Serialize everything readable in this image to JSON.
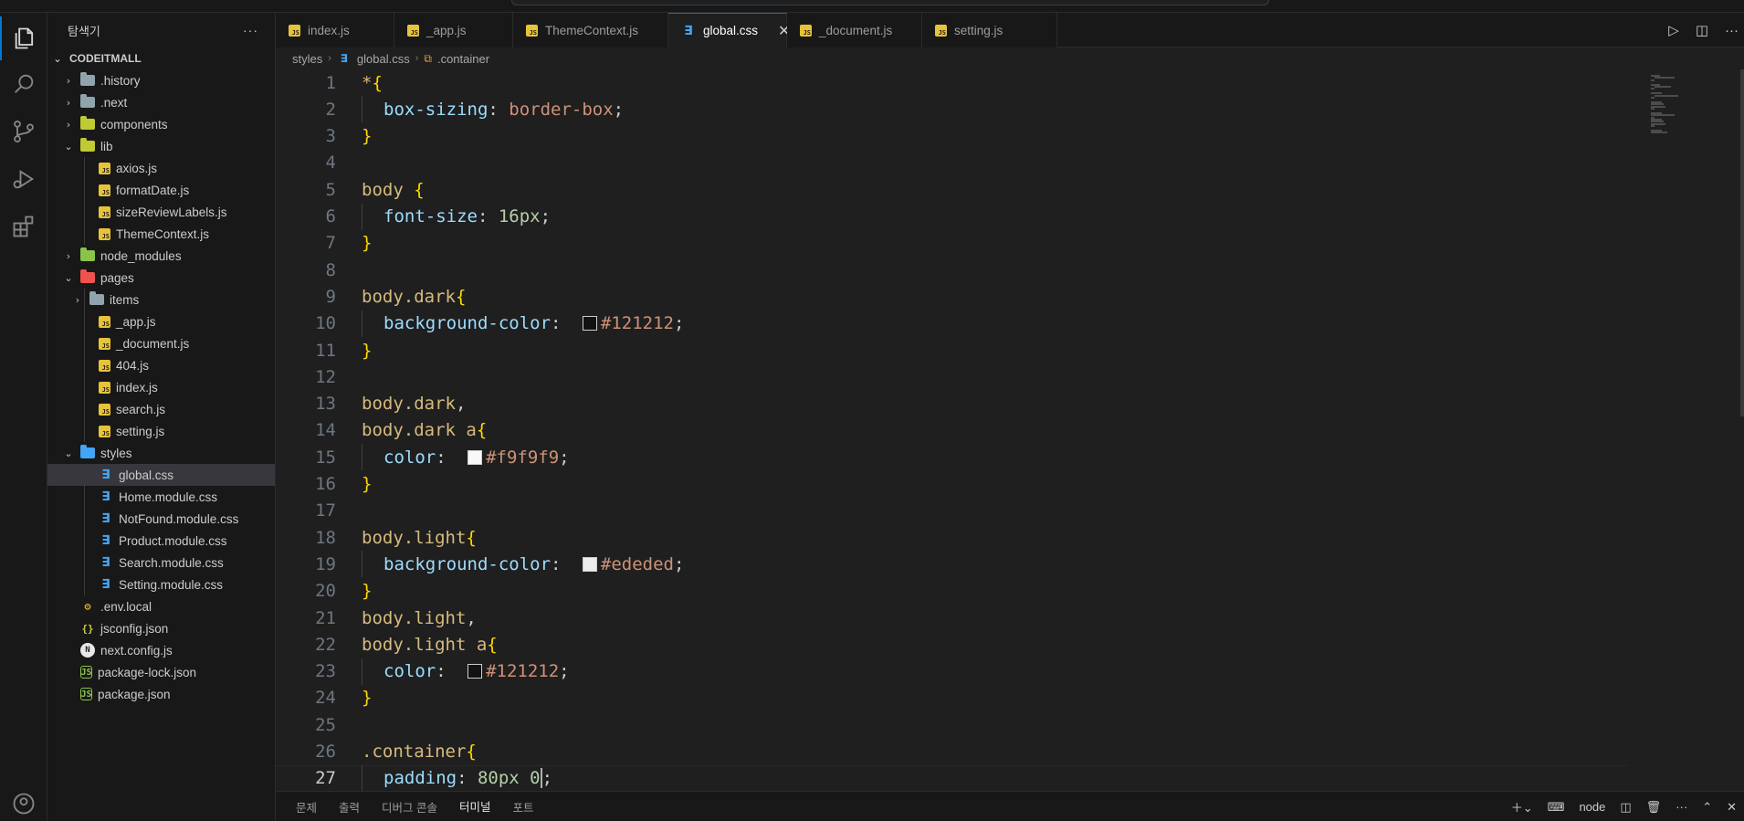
{
  "sidebar": {
    "title": "탐색기",
    "more": "···",
    "root": "CODEITMALL",
    "items": [
      {
        "label": ".history",
        "kind": "folder",
        "color": "#90a4ae",
        "open": false,
        "depth": 1
      },
      {
        "label": ".next",
        "kind": "folder",
        "color": "#90a4ae",
        "open": false,
        "depth": 1
      },
      {
        "label": "components",
        "kind": "folder",
        "color": "#c0ca33",
        "open": false,
        "depth": 1
      },
      {
        "label": "lib",
        "kind": "folder",
        "color": "#c0ca33",
        "open": true,
        "depth": 1
      },
      {
        "label": "axios.js",
        "kind": "js",
        "depth": 2
      },
      {
        "label": "formatDate.js",
        "kind": "js",
        "depth": 2
      },
      {
        "label": "sizeReviewLabels.js",
        "kind": "js",
        "depth": 2
      },
      {
        "label": "ThemeContext.js",
        "kind": "js",
        "depth": 2
      },
      {
        "label": "node_modules",
        "kind": "folder",
        "color": "#8bc34a",
        "open": false,
        "depth": 1
      },
      {
        "label": "pages",
        "kind": "folder",
        "color": "#ef5350",
        "open": true,
        "depth": 1
      },
      {
        "label": "items",
        "kind": "folder",
        "color": "#90a4ae",
        "open": false,
        "depth": 2
      },
      {
        "label": "_app.js",
        "kind": "js",
        "depth": 2
      },
      {
        "label": "_document.js",
        "kind": "js",
        "depth": 2
      },
      {
        "label": "404.js",
        "kind": "js",
        "depth": 2
      },
      {
        "label": "index.js",
        "kind": "js",
        "depth": 2
      },
      {
        "label": "search.js",
        "kind": "js",
        "depth": 2
      },
      {
        "label": "setting.js",
        "kind": "js",
        "depth": 2
      },
      {
        "label": "styles",
        "kind": "folder",
        "color": "#42a5f5",
        "open": true,
        "depth": 1
      },
      {
        "label": "global.css",
        "kind": "css",
        "depth": 2,
        "selected": true
      },
      {
        "label": "Home.module.css",
        "kind": "css",
        "depth": 2
      },
      {
        "label": "NotFound.module.css",
        "kind": "css",
        "depth": 2
      },
      {
        "label": "Product.module.css",
        "kind": "css",
        "depth": 2
      },
      {
        "label": "Search.module.css",
        "kind": "css",
        "depth": 2
      },
      {
        "label": "Setting.module.css",
        "kind": "css",
        "depth": 2
      },
      {
        "label": ".env.local",
        "kind": "env",
        "depth": 1
      },
      {
        "label": "jsconfig.json",
        "kind": "json",
        "depth": 1
      },
      {
        "label": "next.config.js",
        "kind": "next",
        "depth": 1
      },
      {
        "label": "package-lock.json",
        "kind": "node",
        "depth": 1
      },
      {
        "label": "package.json",
        "kind": "node",
        "depth": 1
      }
    ]
  },
  "tabs": [
    {
      "label": "index.js",
      "kind": "js"
    },
    {
      "label": "_app.js",
      "kind": "js"
    },
    {
      "label": "ThemeContext.js",
      "kind": "js"
    },
    {
      "label": "global.css",
      "kind": "css",
      "active": true
    },
    {
      "label": "_document.js",
      "kind": "js"
    },
    {
      "label": "setting.js",
      "kind": "js"
    }
  ],
  "breadcrumbs": {
    "folder": "styles",
    "file": "global.css",
    "symbol": ".container"
  },
  "code": {
    "current_line": 27,
    "lines": [
      {
        "n": "1",
        "t": [
          [
            "sel",
            "*"
          ],
          [
            "brace",
            "{"
          ]
        ]
      },
      {
        "n": "2",
        "indent": true,
        "t": [
          [
            "prop",
            "box-sizing"
          ],
          [
            "punc",
            ": "
          ],
          [
            "val",
            "border-box"
          ],
          [
            "punc",
            ";"
          ]
        ]
      },
      {
        "n": "3",
        "t": [
          [
            "brace",
            "}"
          ]
        ]
      },
      {
        "n": "4",
        "t": []
      },
      {
        "n": "5",
        "t": [
          [
            "sel",
            "body "
          ],
          [
            "brace",
            "{"
          ]
        ]
      },
      {
        "n": "6",
        "indent": true,
        "t": [
          [
            "prop",
            "font-size"
          ],
          [
            "punc",
            ": "
          ],
          [
            "num",
            "16px"
          ],
          [
            "punc",
            ";"
          ]
        ]
      },
      {
        "n": "7",
        "t": [
          [
            "brace",
            "}"
          ]
        ]
      },
      {
        "n": "8",
        "t": []
      },
      {
        "n": "9",
        "t": [
          [
            "sel",
            "body.dark"
          ],
          [
            "brace",
            "{"
          ]
        ]
      },
      {
        "n": "10",
        "indent": true,
        "swatch": "#121212",
        "t": [
          [
            "prop",
            "background-color"
          ],
          [
            "punc",
            ": "
          ],
          [
            "swatch",
            ""
          ],
          [
            "val",
            "#121212"
          ],
          [
            "punc",
            ";"
          ]
        ]
      },
      {
        "n": "11",
        "t": [
          [
            "brace",
            "}"
          ]
        ]
      },
      {
        "n": "12",
        "t": []
      },
      {
        "n": "13",
        "t": [
          [
            "sel",
            "body.dark"
          ],
          [
            "punc",
            ","
          ]
        ]
      },
      {
        "n": "14",
        "t": [
          [
            "sel",
            "body.dark a"
          ],
          [
            "brace",
            "{"
          ]
        ]
      },
      {
        "n": "15",
        "indent": true,
        "swatch": "#f9f9f9",
        "t": [
          [
            "prop",
            "color"
          ],
          [
            "punc",
            ": "
          ],
          [
            "swatch",
            ""
          ],
          [
            "val",
            "#f9f9f9"
          ],
          [
            "punc",
            ";"
          ]
        ]
      },
      {
        "n": "16",
        "t": [
          [
            "brace",
            "}"
          ]
        ]
      },
      {
        "n": "17",
        "t": []
      },
      {
        "n": "18",
        "t": [
          [
            "sel",
            "body.light"
          ],
          [
            "brace",
            "{"
          ]
        ]
      },
      {
        "n": "19",
        "indent": true,
        "swatch": "#ededed",
        "t": [
          [
            "prop",
            "background-color"
          ],
          [
            "punc",
            ": "
          ],
          [
            "swatch",
            ""
          ],
          [
            "val",
            "#ededed"
          ],
          [
            "punc",
            ";"
          ]
        ]
      },
      {
        "n": "20",
        "t": [
          [
            "brace",
            "}"
          ]
        ]
      },
      {
        "n": "21",
        "t": [
          [
            "sel",
            "body.light"
          ],
          [
            "punc",
            ","
          ]
        ]
      },
      {
        "n": "22",
        "t": [
          [
            "sel",
            "body.light a"
          ],
          [
            "brace",
            "{"
          ]
        ]
      },
      {
        "n": "23",
        "indent": true,
        "swatch": "#121212",
        "t": [
          [
            "prop",
            "color"
          ],
          [
            "punc",
            ": "
          ],
          [
            "swatch",
            ""
          ],
          [
            "val",
            "#121212"
          ],
          [
            "punc",
            ";"
          ]
        ]
      },
      {
        "n": "24",
        "t": [
          [
            "brace",
            "}"
          ]
        ]
      },
      {
        "n": "25",
        "t": []
      },
      {
        "n": "26",
        "t": [
          [
            "sel",
            ".container"
          ],
          [
            "brace",
            "{"
          ]
        ]
      },
      {
        "n": "27",
        "indent": true,
        "t": [
          [
            "prop",
            "padding"
          ],
          [
            "punc",
            ": "
          ],
          [
            "num",
            "80px 0"
          ],
          [
            "cursor",
            ""
          ],
          [
            "punc",
            ";"
          ]
        ]
      }
    ]
  },
  "panel": {
    "tabs": [
      "문제",
      "출력",
      "디버그 콘솔",
      "터미널",
      "포트"
    ],
    "active_tab": "터미널",
    "terminal_name": "node"
  },
  "colors": {
    "accent": "#0078d4",
    "js_icon": "#e8c33a",
    "css_icon": "#42a5f5",
    "selector": "#d7ba7d",
    "property": "#9cdcfe",
    "value": "#ce9178",
    "number": "#b5cea8",
    "bracket": "#ffd700"
  },
  "icons": {
    "activity": [
      "files-icon",
      "search-icon",
      "source-control-icon",
      "run-debug-icon",
      "extensions-icon"
    ],
    "editor_actions": [
      "run-icon",
      "split-editor-icon",
      "more-icon"
    ]
  }
}
